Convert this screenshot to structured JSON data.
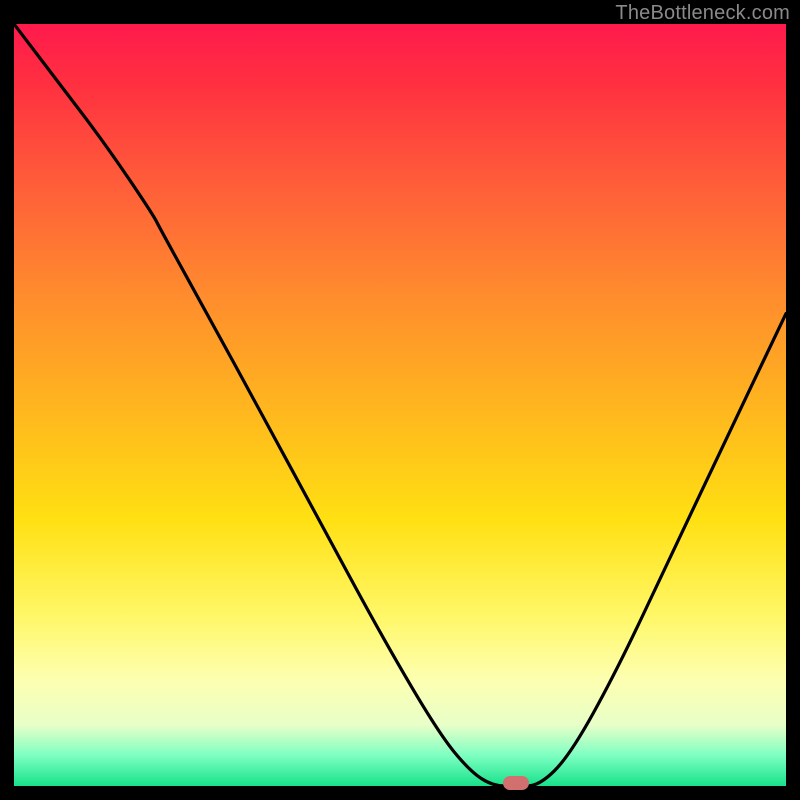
{
  "watermark": "TheBottleneck.com",
  "colors": {
    "background": "#000000",
    "curve": "#000000",
    "marker": "#d1706e"
  },
  "chart_data": {
    "type": "line",
    "title": "",
    "xlabel": "",
    "ylabel": "",
    "xlim": [
      0,
      100
    ],
    "ylim": [
      0,
      100
    ],
    "grid": false,
    "legend": false,
    "gradient_stops": [
      {
        "pos": 0,
        "color": "#ff1a4d"
      },
      {
        "pos": 8,
        "color": "#ff3040"
      },
      {
        "pos": 20,
        "color": "#ff5a3a"
      },
      {
        "pos": 35,
        "color": "#ff8a2e"
      },
      {
        "pos": 50,
        "color": "#ffb51f"
      },
      {
        "pos": 65,
        "color": "#ffe012"
      },
      {
        "pos": 78,
        "color": "#fff86a"
      },
      {
        "pos": 86,
        "color": "#fdffb0"
      },
      {
        "pos": 92,
        "color": "#e8ffc8"
      },
      {
        "pos": 96,
        "color": "#7dffc2"
      },
      {
        "pos": 100,
        "color": "#17e28a"
      }
    ],
    "series": [
      {
        "name": "bottleneck-curve",
        "x": [
          0,
          6,
          12,
          18,
          19,
          25,
          32,
          40,
          48,
          55,
          59,
          62,
          65,
          68,
          72,
          78,
          85,
          92,
          100
        ],
        "values": [
          100,
          92,
          84,
          75,
          73,
          62,
          49,
          34,
          19,
          7,
          2,
          0,
          0,
          0,
          4,
          15,
          30,
          45,
          62
        ]
      }
    ],
    "marker": {
      "x": 65,
      "y": 0,
      "shape": "pill",
      "color": "#d1706e"
    }
  }
}
